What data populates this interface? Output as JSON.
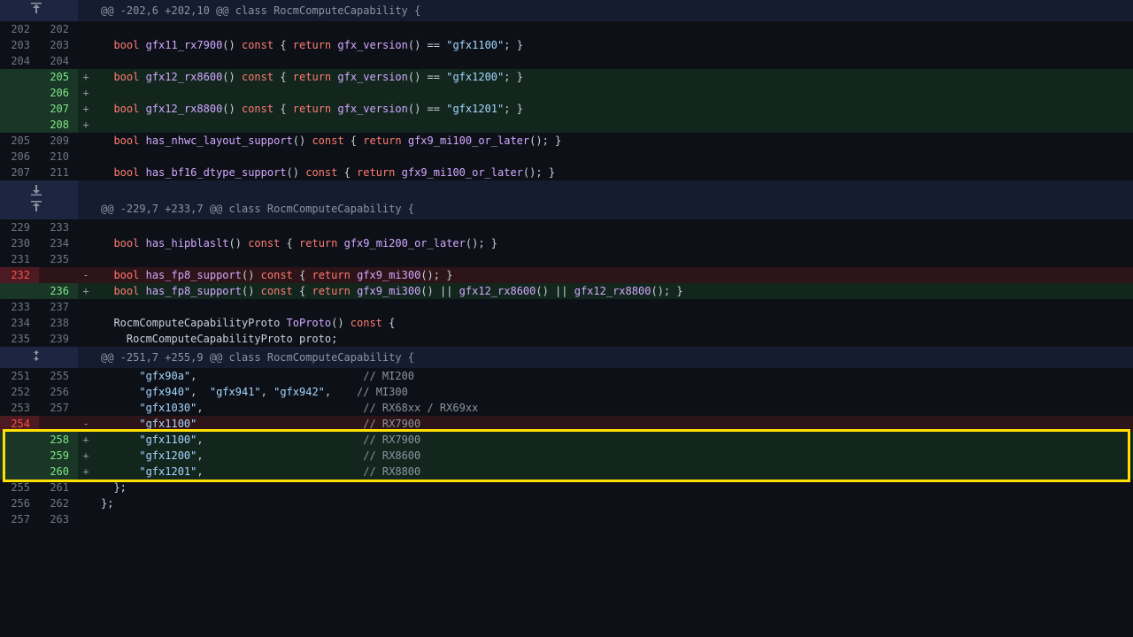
{
  "hunks": [
    {
      "kind": "expand-up",
      "icon": "up"
    },
    {
      "kind": "hunk",
      "text": "@@ -202,6 +202,10 @@ class RocmComputeCapability {"
    },
    {
      "kind": "ctx",
      "old": "202",
      "new": "202",
      "tokens": []
    },
    {
      "kind": "ctx",
      "old": "203",
      "new": "203",
      "tokens": [
        [
          "",
          "  "
        ],
        [
          "tok-k",
          "bool"
        ],
        [
          "",
          " "
        ],
        [
          "tok-f",
          "gfx11_rx7900"
        ],
        [
          "",
          "() "
        ],
        [
          "tok-k",
          "const"
        ],
        [
          "",
          " { "
        ],
        [
          "tok-k",
          "return"
        ],
        [
          "",
          " "
        ],
        [
          "tok-f",
          "gfx_version"
        ],
        [
          "",
          "() == "
        ],
        [
          "tok-s",
          "\"gfx1100\""
        ],
        [
          "",
          "; }"
        ]
      ]
    },
    {
      "kind": "ctx",
      "old": "204",
      "new": "204",
      "tokens": []
    },
    {
      "kind": "add",
      "new": "205",
      "tokens": [
        [
          "",
          "  "
        ],
        [
          "tok-k",
          "bool"
        ],
        [
          "",
          " "
        ],
        [
          "tok-f",
          "gfx12_rx8600"
        ],
        [
          "",
          "() "
        ],
        [
          "tok-k",
          "const"
        ],
        [
          "",
          " { "
        ],
        [
          "tok-k",
          "return"
        ],
        [
          "",
          " "
        ],
        [
          "tok-f",
          "gfx_version"
        ],
        [
          "",
          "() == "
        ],
        [
          "tok-s",
          "\"gfx1200\""
        ],
        [
          "",
          "; }"
        ]
      ]
    },
    {
      "kind": "add",
      "new": "206",
      "tokens": []
    },
    {
      "kind": "add",
      "new": "207",
      "tokens": [
        [
          "",
          "  "
        ],
        [
          "tok-k",
          "bool"
        ],
        [
          "",
          " "
        ],
        [
          "tok-f",
          "gfx12_rx8800"
        ],
        [
          "",
          "() "
        ],
        [
          "tok-k",
          "const"
        ],
        [
          "",
          " { "
        ],
        [
          "tok-k",
          "return"
        ],
        [
          "",
          " "
        ],
        [
          "tok-f",
          "gfx_version"
        ],
        [
          "",
          "() == "
        ],
        [
          "tok-s",
          "\"gfx1201\""
        ],
        [
          "",
          "; }"
        ]
      ]
    },
    {
      "kind": "add",
      "new": "208",
      "tokens": []
    },
    {
      "kind": "ctx",
      "old": "205",
      "new": "209",
      "tokens": [
        [
          "",
          "  "
        ],
        [
          "tok-k",
          "bool"
        ],
        [
          "",
          " "
        ],
        [
          "tok-f",
          "has_nhwc_layout_support"
        ],
        [
          "",
          "() "
        ],
        [
          "tok-k",
          "const"
        ],
        [
          "",
          " { "
        ],
        [
          "tok-k",
          "return"
        ],
        [
          "",
          " "
        ],
        [
          "tok-f",
          "gfx9_mi100_or_later"
        ],
        [
          "",
          "(); }"
        ]
      ]
    },
    {
      "kind": "ctx",
      "old": "206",
      "new": "210",
      "tokens": []
    },
    {
      "kind": "ctx",
      "old": "207",
      "new": "211",
      "tokens": [
        [
          "",
          "  "
        ],
        [
          "tok-k",
          "bool"
        ],
        [
          "",
          " "
        ],
        [
          "tok-f",
          "has_bf16_dtype_support"
        ],
        [
          "",
          "() "
        ],
        [
          "tok-k",
          "const"
        ],
        [
          "",
          " { "
        ],
        [
          "tok-k",
          "return"
        ],
        [
          "",
          " "
        ],
        [
          "tok-f",
          "gfx9_mi100_or_later"
        ],
        [
          "",
          "(); }"
        ]
      ]
    },
    {
      "kind": "expand-down",
      "icon": "down"
    },
    {
      "kind": "expand-up",
      "icon": "up"
    },
    {
      "kind": "hunk",
      "text": "@@ -229,7 +233,7 @@ class RocmComputeCapability {"
    },
    {
      "kind": "ctx",
      "old": "229",
      "new": "233",
      "tokens": []
    },
    {
      "kind": "ctx",
      "old": "230",
      "new": "234",
      "tokens": [
        [
          "",
          "  "
        ],
        [
          "tok-k",
          "bool"
        ],
        [
          "",
          " "
        ],
        [
          "tok-f",
          "has_hipblaslt"
        ],
        [
          "",
          "() "
        ],
        [
          "tok-k",
          "const"
        ],
        [
          "",
          " { "
        ],
        [
          "tok-k",
          "return"
        ],
        [
          "",
          " "
        ],
        [
          "tok-f",
          "gfx9_mi200_or_later"
        ],
        [
          "",
          "(); }"
        ]
      ]
    },
    {
      "kind": "ctx",
      "old": "231",
      "new": "235",
      "tokens": []
    },
    {
      "kind": "del",
      "old": "232",
      "tokens": [
        [
          "",
          "  "
        ],
        [
          "tok-k",
          "bool"
        ],
        [
          "",
          " "
        ],
        [
          "tok-f",
          "has_fp8_support"
        ],
        [
          "",
          "() "
        ],
        [
          "tok-k",
          "const"
        ],
        [
          "",
          " { "
        ],
        [
          "tok-k",
          "return"
        ],
        [
          "",
          " "
        ],
        [
          "tok-f",
          "gfx9_mi300"
        ],
        [
          "",
          "(); }"
        ]
      ]
    },
    {
      "kind": "add",
      "new": "236",
      "tokens": [
        [
          "",
          "  "
        ],
        [
          "tok-k",
          "bool"
        ],
        [
          "",
          " "
        ],
        [
          "tok-f",
          "has_fp8_support"
        ],
        [
          "",
          "() "
        ],
        [
          "tok-k",
          "const"
        ],
        [
          "",
          " { "
        ],
        [
          "tok-k",
          "return"
        ],
        [
          "",
          " "
        ],
        [
          "tok-f",
          "gfx9_mi300"
        ],
        [
          "",
          "() || "
        ],
        [
          "tok-f",
          "gfx12_rx8600"
        ],
        [
          "",
          "() || "
        ],
        [
          "tok-f",
          "gfx12_rx8800"
        ],
        [
          "",
          "(); }"
        ]
      ]
    },
    {
      "kind": "ctx",
      "old": "233",
      "new": "237",
      "tokens": []
    },
    {
      "kind": "ctx",
      "old": "234",
      "new": "238",
      "tokens": [
        [
          "",
          "  RocmComputeCapabilityProto "
        ],
        [
          "tok-f",
          "ToProto"
        ],
        [
          "",
          "() "
        ],
        [
          "tok-k",
          "const"
        ],
        [
          "",
          " {"
        ]
      ]
    },
    {
      "kind": "ctx",
      "old": "235",
      "new": "239",
      "tokens": [
        [
          "",
          "    RocmComputeCapabilityProto proto;"
        ]
      ]
    },
    {
      "kind": "expand-both",
      "icon": "both"
    },
    {
      "kind": "hunk",
      "text": "@@ -251,7 +255,9 @@ class RocmComputeCapability {"
    },
    {
      "kind": "ctx",
      "old": "251",
      "new": "255",
      "tokens": [
        [
          "",
          "      "
        ],
        [
          "tok-s",
          "\"gfx90a\""
        ],
        [
          "",
          ",                          "
        ],
        [
          "tok-com",
          "// MI200"
        ]
      ]
    },
    {
      "kind": "ctx",
      "old": "252",
      "new": "256",
      "tokens": [
        [
          "",
          "      "
        ],
        [
          "tok-s",
          "\"gfx940\""
        ],
        [
          "",
          ",  "
        ],
        [
          "tok-s",
          "\"gfx941\""
        ],
        [
          "",
          ", "
        ],
        [
          "tok-s",
          "\"gfx942\""
        ],
        [
          "",
          ",    "
        ],
        [
          "tok-com",
          "// MI300"
        ]
      ]
    },
    {
      "kind": "ctx",
      "old": "253",
      "new": "257",
      "tokens": [
        [
          "",
          "      "
        ],
        [
          "tok-s",
          "\"gfx1030\""
        ],
        [
          "",
          ",                         "
        ],
        [
          "tok-com",
          "// RX68xx / RX69xx"
        ]
      ]
    },
    {
      "kind": "del",
      "old": "254",
      "tokens": [
        [
          "",
          "      "
        ],
        [
          "tok-s",
          "\"gfx1100\""
        ],
        [
          "",
          "                          "
        ],
        [
          "tok-com",
          "// RX7900"
        ]
      ]
    },
    {
      "kind": "add",
      "new": "258",
      "hl": true,
      "tokens": [
        [
          "",
          "      "
        ],
        [
          "tok-s",
          "\"gfx1100\""
        ],
        [
          "",
          ",                         "
        ],
        [
          "tok-com",
          "// RX7900"
        ]
      ]
    },
    {
      "kind": "add",
      "new": "259",
      "hl": true,
      "tokens": [
        [
          "",
          "      "
        ],
        [
          "tok-s",
          "\"gfx1200\""
        ],
        [
          "",
          ",                         "
        ],
        [
          "tok-com",
          "// RX8600"
        ]
      ]
    },
    {
      "kind": "add",
      "new": "260",
      "hl": true,
      "tokens": [
        [
          "",
          "      "
        ],
        [
          "tok-s",
          "\"gfx1201\""
        ],
        [
          "",
          ",                         "
        ],
        [
          "tok-com",
          "// RX8800"
        ]
      ]
    },
    {
      "kind": "ctx",
      "old": "255",
      "new": "261",
      "tokens": [
        [
          "",
          "  };"
        ]
      ]
    },
    {
      "kind": "ctx",
      "old": "256",
      "new": "262",
      "tokens": [
        [
          "",
          "};"
        ]
      ]
    },
    {
      "kind": "ctx",
      "old": "257",
      "new": "263",
      "tokens": []
    }
  ]
}
